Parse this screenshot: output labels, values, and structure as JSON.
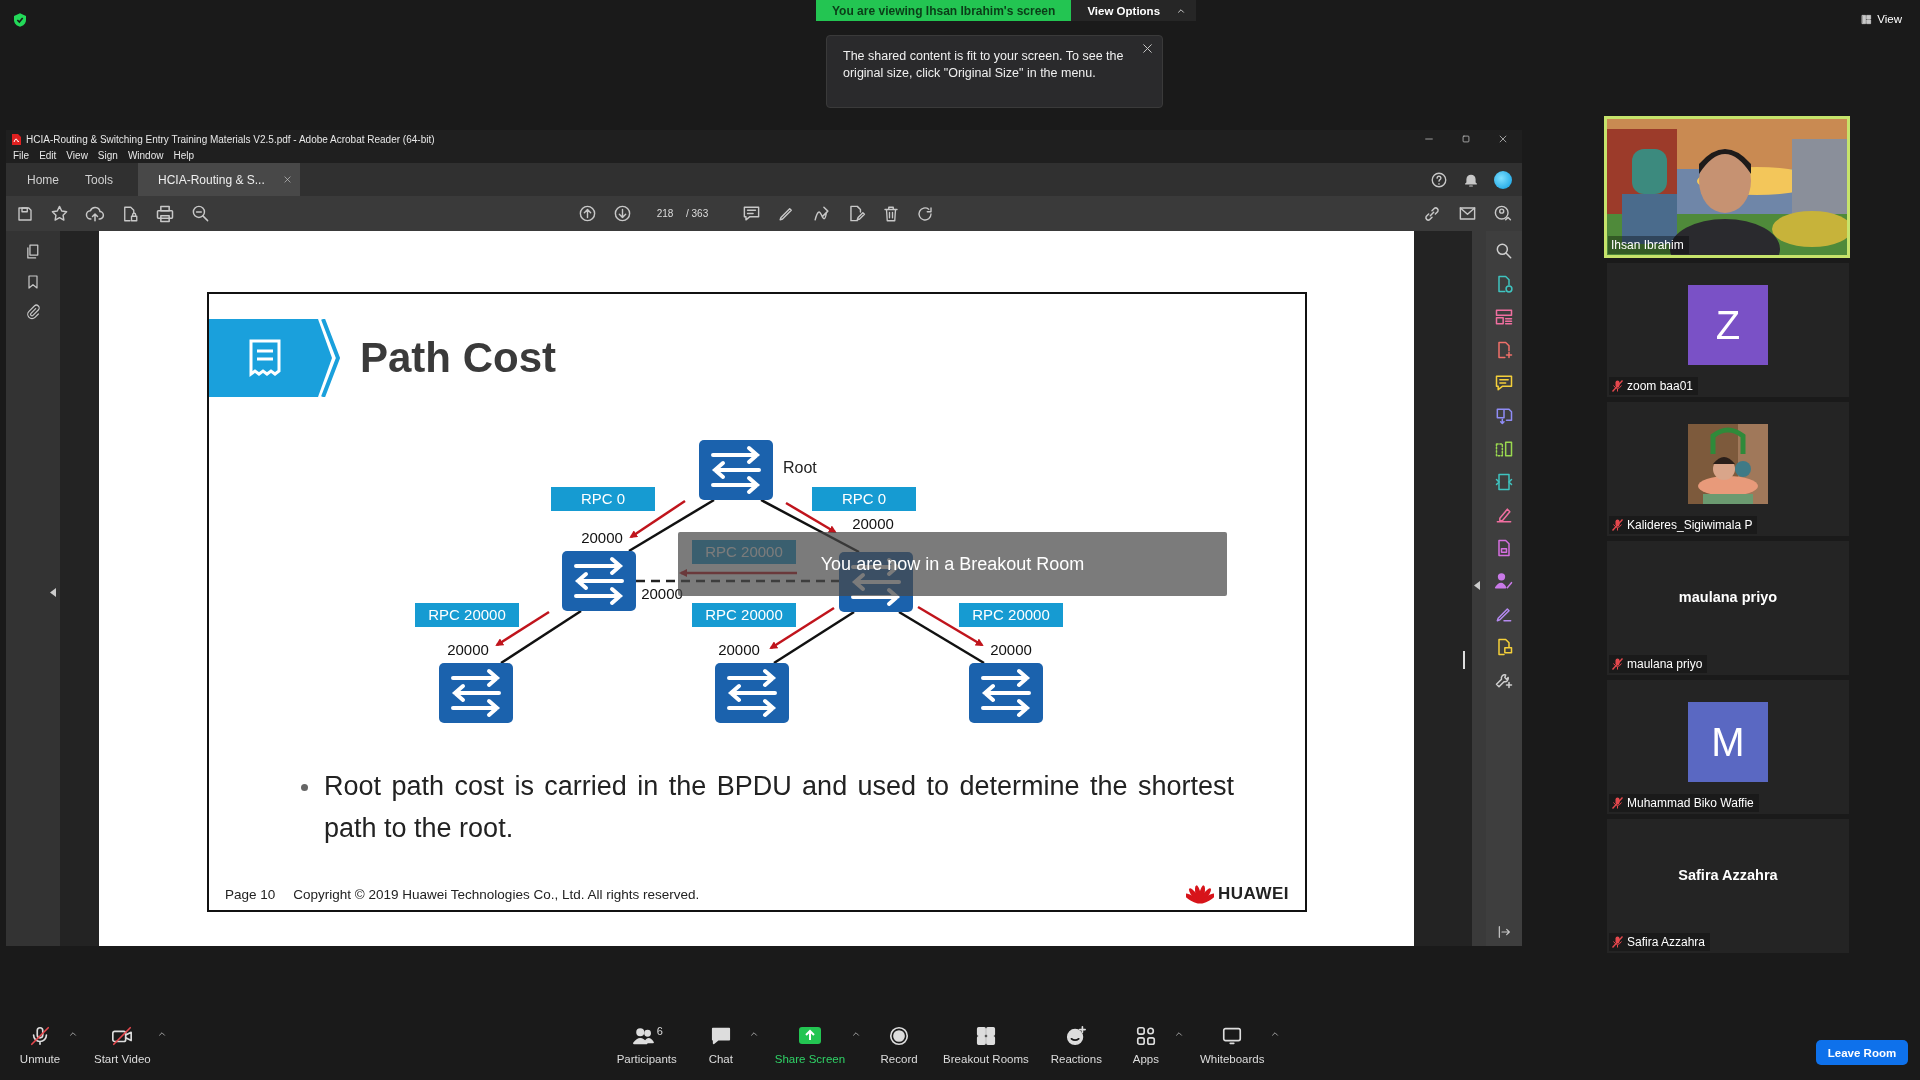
{
  "top_bar": {
    "banner": "You are viewing Ihsan Ibrahim's screen",
    "view_options": "View Options",
    "view_button": "View"
  },
  "tooltip": {
    "text": "The shared content is fit to your screen. To see the original size, click \"Original Size\" in the menu."
  },
  "acrobat": {
    "title": "HCIA-Routing & Switching Entry Training Materials V2.5.pdf - Adobe Acrobat Reader (64-bit)",
    "menu": [
      "File",
      "Edit",
      "View",
      "Sign",
      "Window",
      "Help"
    ],
    "tabs": [
      {
        "label": "Home",
        "selected": false,
        "closable": false
      },
      {
        "label": "Tools",
        "selected": false,
        "closable": false
      },
      {
        "label": "HCIA-Routing & S...",
        "selected": true,
        "closable": true
      }
    ],
    "page_number": "218",
    "page_total": "/ 363"
  },
  "slide": {
    "title": "Path Cost",
    "diagram": {
      "root_label": "Root",
      "rpc_labels": [
        {
          "text": "RPC 0"
        },
        {
          "text": "RPC 0"
        },
        {
          "text": "RPC 20000"
        },
        {
          "text": "RPC 20000"
        },
        {
          "text": "RPC 20000"
        },
        {
          "text": "RPC 20000"
        }
      ],
      "costs": [
        "20000",
        "20000",
        "20000",
        "20000",
        "20000",
        "20000"
      ]
    },
    "bullet": "Root path cost is carried in the BPDU and used to determine the shortest path to the root.",
    "footer_page": "Page 10",
    "copyright": "Copyright © 2019 Huawei Technologies Co., Ltd. All rights reserved.",
    "logo": "HUAWEI"
  },
  "notice": "You are now in a Breakout Room",
  "participants": [
    {
      "kind": "video",
      "name": "Ihsan Ibrahim",
      "speaking": true,
      "muted": false
    },
    {
      "kind": "letter",
      "letter": "Z",
      "color": "#7a51c6",
      "name": "zoom baa01",
      "speaking": false,
      "muted": true
    },
    {
      "name": "Kalideres_Sigiwimala P",
      "speaking": false,
      "muted": true
    },
    {
      "kind": "name",
      "display": "maulana priyo",
      "name": "maulana priyo",
      "speaking": false,
      "muted": true
    },
    {
      "kind": "letter",
      "letter": "M",
      "color": "#5a68c2",
      "name": "Muhammad Biko Waffie",
      "speaking": false,
      "muted": true
    },
    {
      "kind": "name",
      "display": "Safira Azzahra",
      "name": "Safira Azzahra",
      "speaking": false,
      "muted": true
    }
  ],
  "toolbar": {
    "left": [
      {
        "kind": "mic",
        "label": "Unmute",
        "menu": true
      },
      {
        "kind": "video",
        "label": "Start Video",
        "menu": true
      }
    ],
    "center": [
      {
        "kind": "participants",
        "label": "Participants",
        "count": "6",
        "menu": false
      },
      {
        "kind": "chat",
        "label": "Chat",
        "menu": true
      },
      {
        "kind": "share",
        "label": "Share Screen",
        "menu": true
      },
      {
        "kind": "record",
        "label": "Record",
        "menu": false
      },
      {
        "kind": "rooms",
        "label": "Breakout Rooms",
        "menu": false
      },
      {
        "kind": "reactions",
        "label": "Reactions",
        "menu": false
      },
      {
        "kind": "apps",
        "label": "Apps",
        "menu": true
      },
      {
        "kind": "whiteboards",
        "label": "Whiteboards",
        "menu": true
      }
    ],
    "leave": "Leave Room"
  }
}
